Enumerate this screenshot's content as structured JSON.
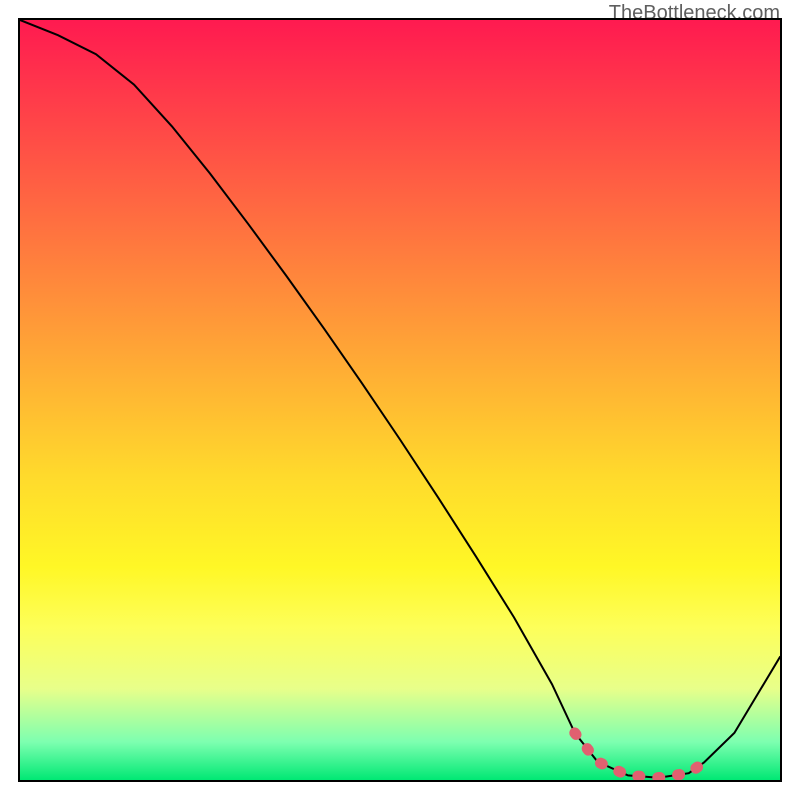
{
  "brand": "TheBottleneck.com",
  "chart_data": {
    "type": "line",
    "title": "",
    "xlabel": "",
    "ylabel": "",
    "xlim": [
      0,
      100
    ],
    "ylim": [
      0,
      100
    ],
    "series": [
      {
        "name": "curve",
        "x": [
          0,
          5,
          10,
          15,
          20,
          25,
          30,
          35,
          40,
          45,
          50,
          55,
          60,
          65,
          70,
          73,
          76,
          80,
          84,
          88,
          90,
          94,
          100
        ],
        "y": [
          100,
          98,
          95.5,
          91.5,
          86,
          79.8,
          73.2,
          66.4,
          59.4,
          52.2,
          44.8,
          37.2,
          29.4,
          21.4,
          12.6,
          6.2,
          2.4,
          0.6,
          0.3,
          0.9,
          2.3,
          6.2,
          16.2
        ]
      },
      {
        "name": "highlight",
        "x": [
          73,
          76,
          80,
          84,
          88,
          90
        ],
        "y": [
          6.2,
          2.4,
          0.6,
          0.3,
          0.9,
          2.3
        ]
      }
    ]
  }
}
